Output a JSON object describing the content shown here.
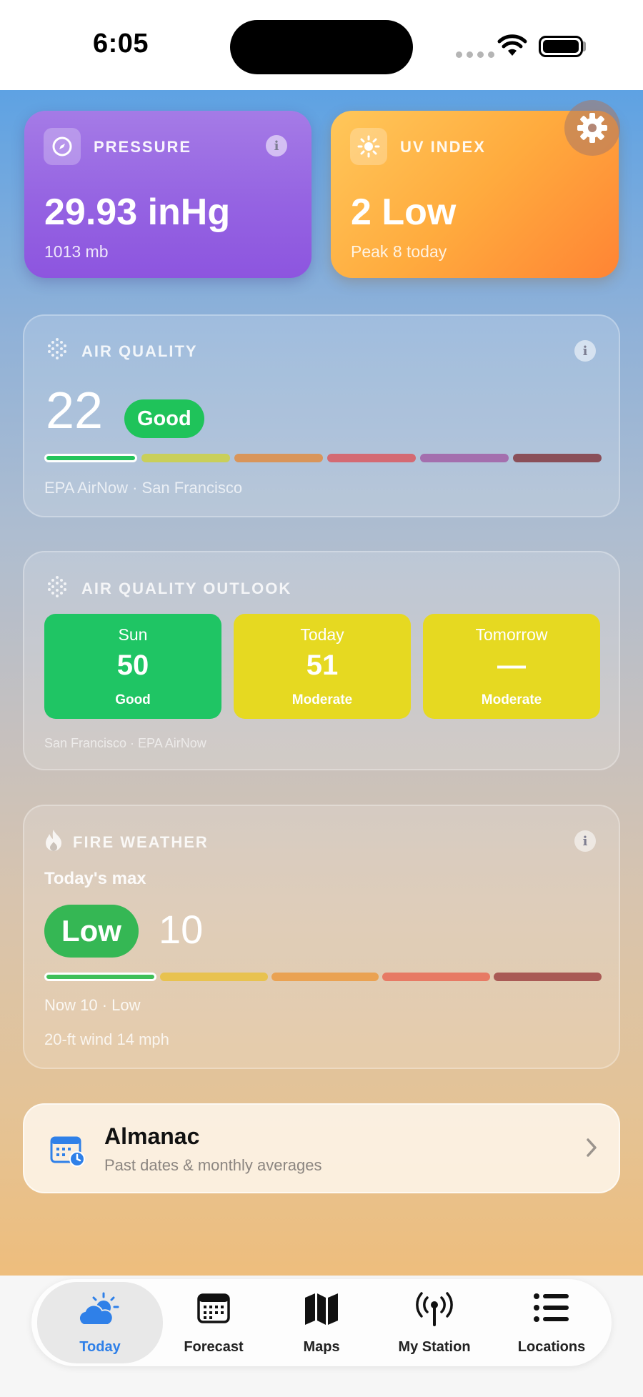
{
  "status_bar": {
    "time": "6:05"
  },
  "tiles": {
    "pressure": {
      "title": "PRESSURE",
      "value": "29.93 inHg",
      "sub": "1013 mb"
    },
    "uv": {
      "title": "UV INDEX",
      "value": "2 Low",
      "sub": "Peak 8 today"
    }
  },
  "air_quality": {
    "title": "AIR QUALITY",
    "value": "22",
    "category": "Good",
    "source": "EPA AirNow · San Francisco",
    "scale_colors": [
      "#23c45b",
      "#c9cf5a",
      "#d9955a",
      "#d46a73",
      "#a46fae",
      "#8a4f59"
    ],
    "active_segment": 0
  },
  "outlook": {
    "title": "AIR QUALITY OUTLOOK",
    "days": [
      {
        "day": "Sun",
        "value": "50",
        "category": "Good",
        "color": "#1fc564"
      },
      {
        "day": "Today",
        "value": "51",
        "category": "Moderate",
        "color": "#e6d921"
      },
      {
        "day": "Tomorrow",
        "value": "—",
        "category": "Moderate",
        "color": "#e6d921"
      }
    ],
    "source": "San Francisco · EPA AirNow"
  },
  "fire_weather": {
    "title": "FIRE WEATHER",
    "today_label": "Today's max",
    "level": "Low",
    "value": "10",
    "now": "Now 10 · Low",
    "wind": "20-ft wind 14 mph",
    "scale_colors": [
      "#3fbf58",
      "#e8c24f",
      "#eaa252",
      "#e77a64",
      "#a95a55"
    ],
    "active_segment": 0
  },
  "almanac": {
    "title": "Almanac",
    "subtitle": "Past dates & monthly averages"
  },
  "tabs": [
    {
      "label": "Today",
      "icon": "weather-partly-sunny-icon",
      "active": true
    },
    {
      "label": "Forecast",
      "icon": "calendar-icon",
      "active": false
    },
    {
      "label": "Maps",
      "icon": "map-icon",
      "active": false
    },
    {
      "label": "My Station",
      "icon": "antenna-icon",
      "active": false
    },
    {
      "label": "Locations",
      "icon": "list-icon",
      "active": false
    }
  ],
  "colors": {
    "accent": "#2f80e8",
    "good": "#1fc35a",
    "moderate": "#e6d921"
  }
}
